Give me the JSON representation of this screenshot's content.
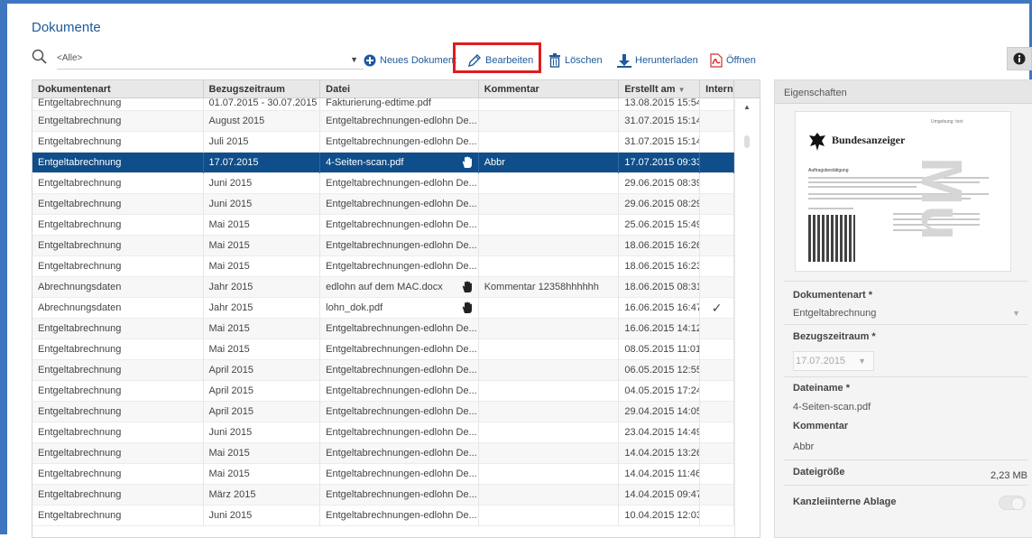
{
  "header": {
    "title": "Dokumente"
  },
  "toolbar": {
    "filter_value": "<Alle>",
    "new_label": "Neues Dokument",
    "edit_label": "Bearbeiten",
    "delete_label": "Löschen",
    "download_label": "Herunterladen",
    "open_label": "Öffnen",
    "accent_color": "#1f5a9a",
    "highlight_color": "#e01c1c"
  },
  "table": {
    "columns": [
      "Dokumentenart",
      "Bezugszeitraum",
      "Datei",
      "Kommentar",
      "Erstellt am",
      "Intern"
    ],
    "sort_indicator": "▼",
    "selected_color": "#0f4e8a",
    "rows": [
      {
        "art": "Entgeltabrechnung",
        "zeitraum": "01.07.2015 - 30.07.2015",
        "datei": "Fakturierung-edtime.pdf",
        "kommentar": "",
        "erstellt": "13.08.2015 15:54",
        "intern": "",
        "hand": false
      },
      {
        "art": "Entgeltabrechnung",
        "zeitraum": "August 2015",
        "datei": "Entgeltabrechnungen-edlohn De...",
        "kommentar": "",
        "erstellt": "31.07.2015 15:14",
        "intern": "",
        "hand": false
      },
      {
        "art": "Entgeltabrechnung",
        "zeitraum": "Juli 2015",
        "datei": "Entgeltabrechnungen-edlohn De...",
        "kommentar": "",
        "erstellt": "31.07.2015 15:14",
        "intern": "",
        "hand": false
      },
      {
        "art": "Entgeltabrechnung",
        "zeitraum": "17.07.2015",
        "datei": "4-Seiten-scan.pdf",
        "kommentar": "Abbr",
        "erstellt": "17.07.2015 09:33",
        "intern": "",
        "hand": true,
        "selected": true
      },
      {
        "art": "Entgeltabrechnung",
        "zeitraum": "Juni 2015",
        "datei": "Entgeltabrechnungen-edlohn De...",
        "kommentar": "",
        "erstellt": "29.06.2015 08:39",
        "intern": "",
        "hand": false
      },
      {
        "art": "Entgeltabrechnung",
        "zeitraum": "Juni 2015",
        "datei": "Entgeltabrechnungen-edlohn De...",
        "kommentar": "",
        "erstellt": "29.06.2015 08:29",
        "intern": "",
        "hand": false
      },
      {
        "art": "Entgeltabrechnung",
        "zeitraum": "Mai 2015",
        "datei": "Entgeltabrechnungen-edlohn De...",
        "kommentar": "",
        "erstellt": "25.06.2015 15:49",
        "intern": "",
        "hand": false
      },
      {
        "art": "Entgeltabrechnung",
        "zeitraum": "Mai 2015",
        "datei": "Entgeltabrechnungen-edlohn De...",
        "kommentar": "",
        "erstellt": "18.06.2015 16:26",
        "intern": "",
        "hand": false
      },
      {
        "art": "Entgeltabrechnung",
        "zeitraum": "Mai 2015",
        "datei": "Entgeltabrechnungen-edlohn De...",
        "kommentar": "",
        "erstellt": "18.06.2015 16:23",
        "intern": "",
        "hand": false
      },
      {
        "art": "Abrechnungsdaten",
        "zeitraum": "Jahr 2015",
        "datei": "edlohn auf dem MAC.docx",
        "kommentar": "Kommentar 12358hhhhhh",
        "erstellt": "18.06.2015 08:31",
        "intern": "",
        "hand": true
      },
      {
        "art": "Abrechnungsdaten",
        "zeitraum": "Jahr 2015",
        "datei": "lohn_dok.pdf",
        "kommentar": "",
        "erstellt": "16.06.2015 16:47",
        "intern": "✓",
        "hand": true
      },
      {
        "art": "Entgeltabrechnung",
        "zeitraum": "Mai 2015",
        "datei": "Entgeltabrechnungen-edlohn De...",
        "kommentar": "",
        "erstellt": "16.06.2015 14:12",
        "intern": "",
        "hand": false
      },
      {
        "art": "Entgeltabrechnung",
        "zeitraum": "Mai 2015",
        "datei": "Entgeltabrechnungen-edlohn De...",
        "kommentar": "",
        "erstellt": "08.05.2015 11:01",
        "intern": "",
        "hand": false
      },
      {
        "art": "Entgeltabrechnung",
        "zeitraum": "April 2015",
        "datei": "Entgeltabrechnungen-edlohn De...",
        "kommentar": "",
        "erstellt": "06.05.2015 12:55",
        "intern": "",
        "hand": false
      },
      {
        "art": "Entgeltabrechnung",
        "zeitraum": "April 2015",
        "datei": "Entgeltabrechnungen-edlohn De...",
        "kommentar": "",
        "erstellt": "04.05.2015 17:24",
        "intern": "",
        "hand": false
      },
      {
        "art": "Entgeltabrechnung",
        "zeitraum": "April 2015",
        "datei": "Entgeltabrechnungen-edlohn De...",
        "kommentar": "",
        "erstellt": "29.04.2015 14:05",
        "intern": "",
        "hand": false
      },
      {
        "art": "Entgeltabrechnung",
        "zeitraum": "Juni 2015",
        "datei": "Entgeltabrechnungen-edlohn De...",
        "kommentar": "",
        "erstellt": "23.04.2015 14:49",
        "intern": "",
        "hand": false
      },
      {
        "art": "Entgeltabrechnung",
        "zeitraum": "Mai 2015",
        "datei": "Entgeltabrechnungen-edlohn De...",
        "kommentar": "",
        "erstellt": "14.04.2015 13:26",
        "intern": "",
        "hand": false
      },
      {
        "art": "Entgeltabrechnung",
        "zeitraum": "Mai 2015",
        "datei": "Entgeltabrechnungen-edlohn De...",
        "kommentar": "",
        "erstellt": "14.04.2015 11:46",
        "intern": "",
        "hand": false
      },
      {
        "art": "Entgeltabrechnung",
        "zeitraum": "März 2015",
        "datei": "Entgeltabrechnungen-edlohn De...",
        "kommentar": "",
        "erstellt": "14.04.2015 09:47",
        "intern": "",
        "hand": false
      },
      {
        "art": "Entgeltabrechnung",
        "zeitraum": "Juni 2015",
        "datei": "Entgeltabrechnungen-edlohn De...",
        "kommentar": "",
        "erstellt": "10.04.2015 12:03",
        "intern": "",
        "hand": false
      }
    ]
  },
  "panel": {
    "title": "Eigenschaften",
    "preview": {
      "title": "Bundesanzeiger",
      "top_right": "Umgebung: test",
      "section": "Auftragsbestätigung"
    },
    "doc_art_label": "Dokumentenart *",
    "doc_art_value": "Entgeltabrechnung",
    "zeitraum_label": "Bezugszeitraum *",
    "zeitraum_value": "17.07.2015",
    "dateiname_label": "Dateiname *",
    "dateiname_value": "4-Seiten-scan.pdf",
    "kommentar_label": "Kommentar",
    "kommentar_value": "Abbr",
    "groesse_label": "Dateigröße",
    "groesse_value": "2,23 MB",
    "intern_label": "Kanzleiinterne Ablage"
  }
}
